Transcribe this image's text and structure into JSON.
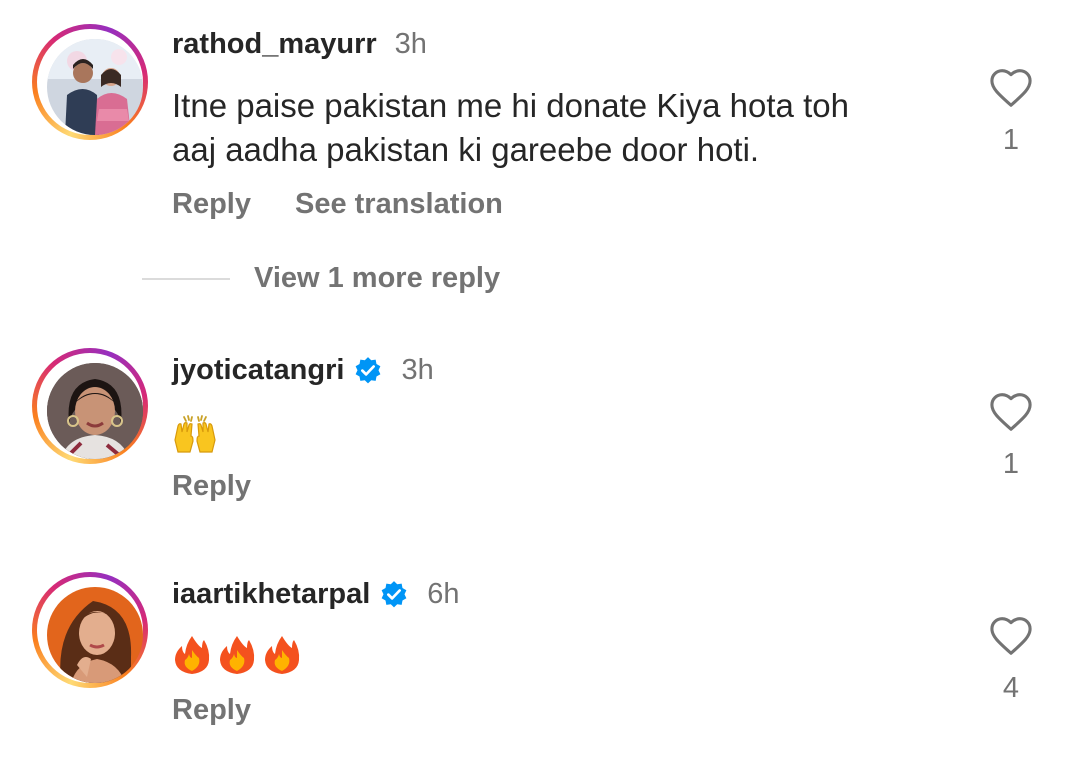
{
  "comments": [
    {
      "username": "rathod_mayurr",
      "verified": false,
      "time": "3h",
      "text_lines": [
        "Itne paise pakistan me hi donate Kiya hota toh",
        "aaj aadha pakistan ki gareebe door hoti."
      ],
      "likes": "1",
      "actions": {
        "reply": "Reply",
        "translate": "See translation"
      },
      "view_more": "View 1 more reply"
    },
    {
      "username": "jyoticatangri",
      "verified": true,
      "time": "3h",
      "emojis": "raising-hands",
      "likes": "1",
      "actions": {
        "reply": "Reply"
      }
    },
    {
      "username": "iaartikhetarpal",
      "verified": true,
      "time": "6h",
      "emojis": "fire x3",
      "likes": "4",
      "actions": {
        "reply": "Reply"
      }
    }
  ],
  "colors": {
    "text": "#262626",
    "secondary": "#737373",
    "verified": "#0095f6",
    "divider": "#dbdbdb"
  },
  "icons": [
    "heart-outline-icon",
    "verified-badge-icon",
    "raising-hands-emoji",
    "fire-emoji"
  ]
}
